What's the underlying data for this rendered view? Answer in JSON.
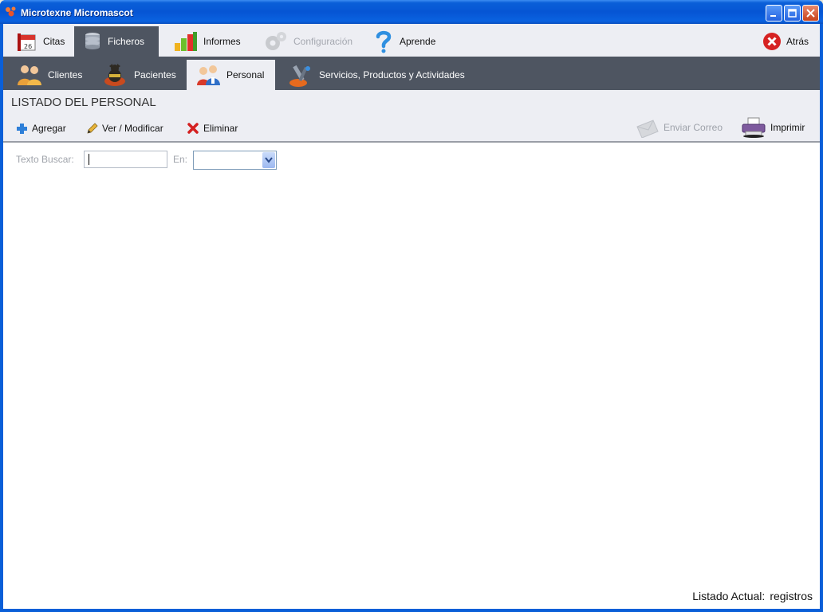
{
  "window": {
    "title": "Microtexne Micromascot"
  },
  "top_menu": {
    "items": [
      {
        "label": "Citas",
        "icon": "calendar-icon"
      },
      {
        "label": "Ficheros",
        "icon": "database-icon"
      },
      {
        "label": "Informes",
        "icon": "bar-chart-icon"
      },
      {
        "label": "Configuración",
        "icon": "gears-icon"
      },
      {
        "label": "Aprende",
        "icon": "question-icon"
      }
    ],
    "active": "Ficheros",
    "back_label": "Atrás"
  },
  "sub_menu": {
    "items": [
      {
        "label": "Clientes",
        "icon": "people-icon"
      },
      {
        "label": "Pacientes",
        "icon": "pet-icon"
      },
      {
        "label": "Personal",
        "icon": "staff-icon"
      },
      {
        "label": "Servicios, Productos y Actividades",
        "icon": "tools-icon"
      }
    ],
    "active": "Personal"
  },
  "page": {
    "title": "LISTADO DEL PERSONAL"
  },
  "toolbar": {
    "add_label": "Agregar",
    "edit_label": "Ver / Modificar",
    "delete_label": "Eliminar",
    "email_label": "Enviar Correo",
    "print_label": "Imprimir"
  },
  "search": {
    "text_label": "Texto Buscar:",
    "text_value": "",
    "in_label": "En:",
    "in_value": ""
  },
  "status": {
    "label": "Listado Actual:",
    "value": "registros"
  }
}
